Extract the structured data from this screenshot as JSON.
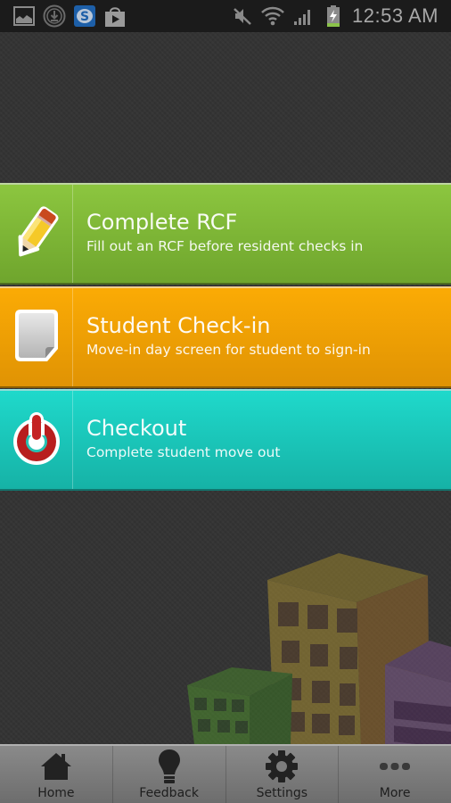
{
  "status_bar": {
    "notification_icons": [
      "gallery-icon",
      "download-icon",
      "skype-icon",
      "play-store-icon"
    ],
    "system_icons": [
      "mute-icon",
      "wifi-icon",
      "signal-icon",
      "battery-charging-icon"
    ],
    "time": "12:53 AM"
  },
  "menu": {
    "items": [
      {
        "title": "Complete RCF",
        "subtitle": "Fill out an RCF before resident checks in",
        "icon": "pencil-icon",
        "color": "#8cc63f"
      },
      {
        "title": "Student Check-in",
        "subtitle": "Move-in day screen for student to sign-in",
        "icon": "document-icon",
        "color": "#fbab05"
      },
      {
        "title": "Checkout",
        "subtitle": "Complete student move out",
        "icon": "power-icon",
        "color": "#1fd9cb"
      }
    ]
  },
  "bottom_nav": {
    "items": [
      {
        "label": "Home",
        "icon": "home-icon"
      },
      {
        "label": "Feedback",
        "icon": "lightbulb-icon"
      },
      {
        "label": "Settings",
        "icon": "gear-icon"
      },
      {
        "label": "More",
        "icon": "more-icon"
      }
    ]
  }
}
